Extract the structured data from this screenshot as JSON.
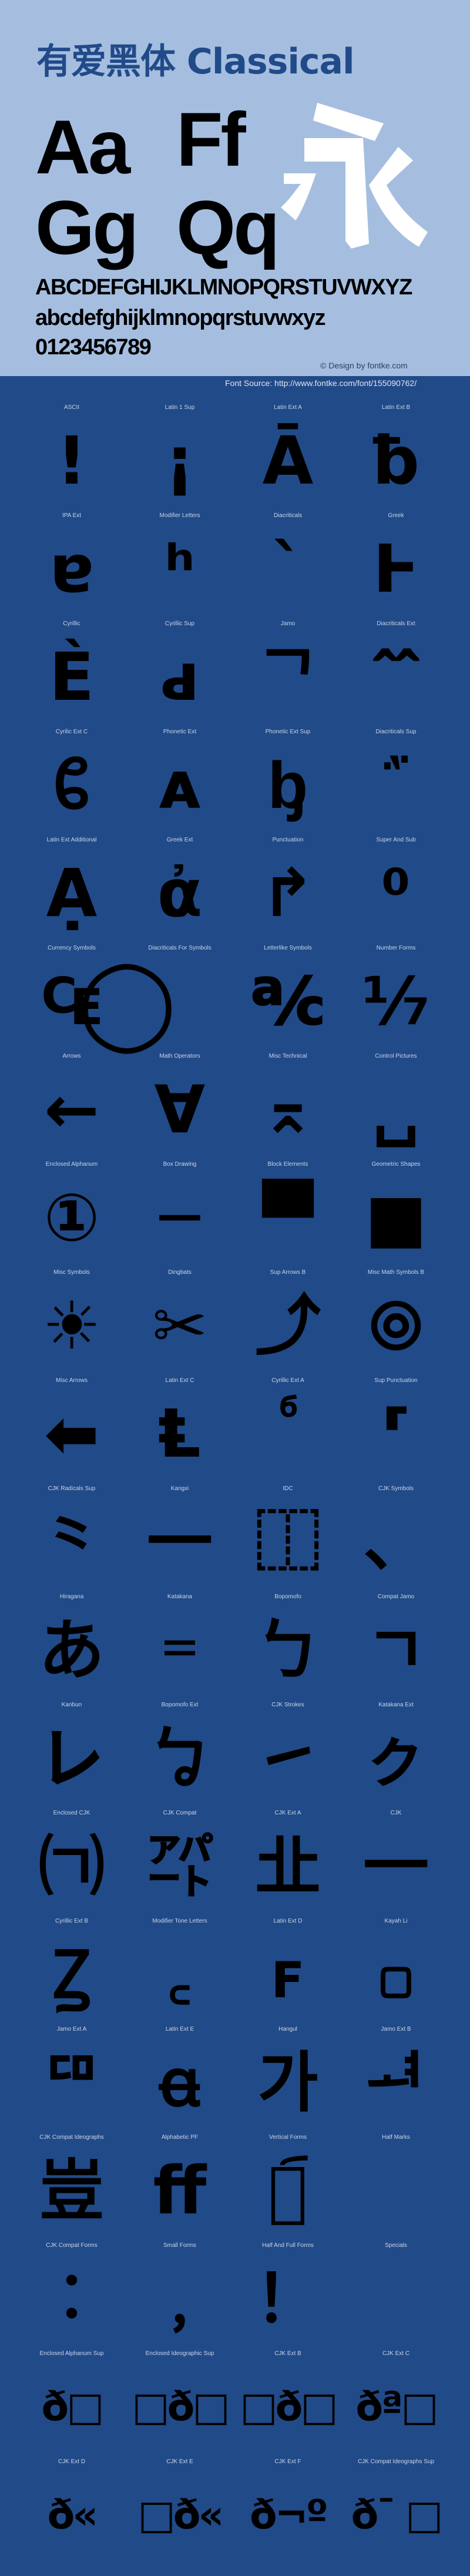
{
  "header": {
    "title": "有爱黑体 Classical",
    "sample_pairs": [
      "Aa",
      "Ff",
      "Gg",
      "Qq"
    ],
    "sample_cjk": "永",
    "uppercase": "ABCDEFGHIJKLMNOPQRSTUVWXYZ",
    "lowercase": "abcdefghijklmnopqrstuvwxyz",
    "digits": "0123456789",
    "credit": "© Design by fontke.com",
    "font_source": "Font Source: http://www.fontke.com/font/155090762/"
  },
  "colors": {
    "header_bg": "#a5bee0",
    "body_bg": "#214a88",
    "title": "#214a88",
    "glyph": "#000000"
  },
  "blocks": [
    {
      "label": "ASCII",
      "glyph": "!"
    },
    {
      "label": "Latin 1 Sup",
      "glyph": "¡"
    },
    {
      "label": "Latin Ext A",
      "glyph": "Ā"
    },
    {
      "label": "Latin Ext B",
      "glyph": "ƀ"
    },
    {
      "label": "IPA Ext",
      "glyph": "ɐ"
    },
    {
      "label": "Modifier Letters",
      "glyph": "ʰ"
    },
    {
      "label": "Diacriticals",
      "glyph": "`"
    },
    {
      "label": "Greek",
      "glyph": "Ͱ"
    },
    {
      "label": "Cyrillic",
      "glyph": "Ѐ"
    },
    {
      "label": "Cyrillic Sup",
      "glyph": "ԁ"
    },
    {
      "label": "Jamo",
      "glyph": "ᄀ"
    },
    {
      "label": "Diacriticals Ext",
      "glyph": "᪰"
    },
    {
      "label": "Cyrilic Ext C",
      "glyph": "ᲀ"
    },
    {
      "label": "Phonetic Ext",
      "glyph": "ᴀ"
    },
    {
      "label": "Phonetic Ext Sup",
      "glyph": "ᶀ"
    },
    {
      "label": "Diacriticals Sup",
      "glyph": "᷀"
    },
    {
      "label": "Latin Ext Additional",
      "glyph": "Ạ"
    },
    {
      "label": "Greek Ext",
      "glyph": "ἀ"
    },
    {
      "label": "Punctuation",
      "glyph": "↱"
    },
    {
      "label": "Super And Sub",
      "glyph": "⁰"
    },
    {
      "label": "Currency Symbols",
      "glyph": "₠"
    },
    {
      "label": "Diacriticals For Symbols",
      "glyph": "◯"
    },
    {
      "label": "Letterlike Symbols",
      "glyph": "℀"
    },
    {
      "label": "Number Forms",
      "glyph": "⅐"
    },
    {
      "label": "Arrows",
      "glyph": "←"
    },
    {
      "label": "Math Operators",
      "glyph": "∀"
    },
    {
      "label": "Misc Technical",
      "glyph": "⌅"
    },
    {
      "label": "Control Pictures",
      "glyph": "␣"
    },
    {
      "label": "Enclosed Alphanum",
      "glyph": "①"
    },
    {
      "label": "Box Drawing",
      "glyph": "─"
    },
    {
      "label": "Block Elements",
      "glyph": "▀"
    },
    {
      "label": "Geometric Shapes",
      "glyph": "■"
    },
    {
      "label": "Misc Symbols",
      "glyph": "☀"
    },
    {
      "label": "Dingbats",
      "glyph": "✂"
    },
    {
      "label": "Sup Arrows B",
      "glyph": "⤴"
    },
    {
      "label": "Misc Math Symbols B",
      "glyph": "⦾"
    },
    {
      "label": "Misc Arrows",
      "glyph": "⬅"
    },
    {
      "label": "Latin Ext C",
      "glyph": "Ⱡ"
    },
    {
      "label": "Cyrillic Ext A",
      "glyph": "ⷠ"
    },
    {
      "label": "Sup Punctuation",
      "glyph": "⸢"
    },
    {
      "label": "CJK Radicals Sup",
      "glyph": "⺀"
    },
    {
      "label": "Kangxi",
      "glyph": "⼀"
    },
    {
      "label": "IDC",
      "glyph": "⿰"
    },
    {
      "label": "CJK Symbols",
      "glyph": "、"
    },
    {
      "label": "Hiragana",
      "glyph": "あ"
    },
    {
      "label": "Katakana",
      "glyph": "゠"
    },
    {
      "label": "Bopomofo",
      "glyph": "ㄅ"
    },
    {
      "label": "Compat Jamo",
      "glyph": "ㄱ"
    },
    {
      "label": "Kanbun",
      "glyph": "㆑"
    },
    {
      "label": "Bopomofo Ext",
      "glyph": "ㆠ"
    },
    {
      "label": "CJK Strokes",
      "glyph": "㇀"
    },
    {
      "label": "Katakana Ext",
      "glyph": "ㇰ"
    },
    {
      "label": "Enclosed CJK",
      "glyph": "㈀"
    },
    {
      "label": "CJK Compat",
      "glyph": "㌀"
    },
    {
      "label": "CJK Ext A",
      "glyph": "㐀"
    },
    {
      "label": "CJK",
      "glyph": "一"
    },
    {
      "label": "Cyrillic Ext B",
      "glyph": "Ꙁ"
    },
    {
      "label": "Modifier Tone Letters",
      "glyph": "꜀"
    },
    {
      "label": "Latin Ext D",
      "glyph": "ꜰ"
    },
    {
      "label": "Kayah Li",
      "glyph": "꤀"
    },
    {
      "label": "Jamo Ext A",
      "glyph": "ꥠ"
    },
    {
      "label": "Latin Ext E",
      "glyph": "ꬰ"
    },
    {
      "label": "Hangul",
      "glyph": "가"
    },
    {
      "label": "Jamo Ext B",
      "glyph": "ힰ"
    },
    {
      "label": "CJK Compat Ideographs",
      "glyph": "豈"
    },
    {
      "label": "Alphabetic PF",
      "glyph": "ﬀ"
    },
    {
      "label": "Vertical Forms",
      "glyph": "︔︠"
    },
    {
      "label": "Half Marks",
      "glyph": ""
    },
    {
      "label": "CJK Compat Forms",
      "glyph": "︰"
    },
    {
      "label": "Small Forms",
      "glyph": "﹐"
    },
    {
      "label": "Half And Full Forms",
      "glyph": "！"
    },
    {
      "label": "Specials",
      "glyph": "￼"
    },
    {
      "label": "Enclosed Alphanum Sup",
      "glyph": "ð□"
    },
    {
      "label": "Enclosed Ideographic Sup",
      "glyph": "□ð□"
    },
    {
      "label": "CJK Ext B",
      "glyph": "□ð□"
    },
    {
      "label": "CJK Ext C",
      "glyph": "ðª□"
    },
    {
      "label": "CJK Ext D",
      "glyph": "ð«"
    },
    {
      "label": "CJK Ext E",
      "glyph": "□ð«"
    },
    {
      "label": "CJK Ext F",
      "glyph": "ð¬º"
    },
    {
      "label": "CJK Compat Ideographs Sup",
      "glyph": "ð¯ □"
    }
  ]
}
